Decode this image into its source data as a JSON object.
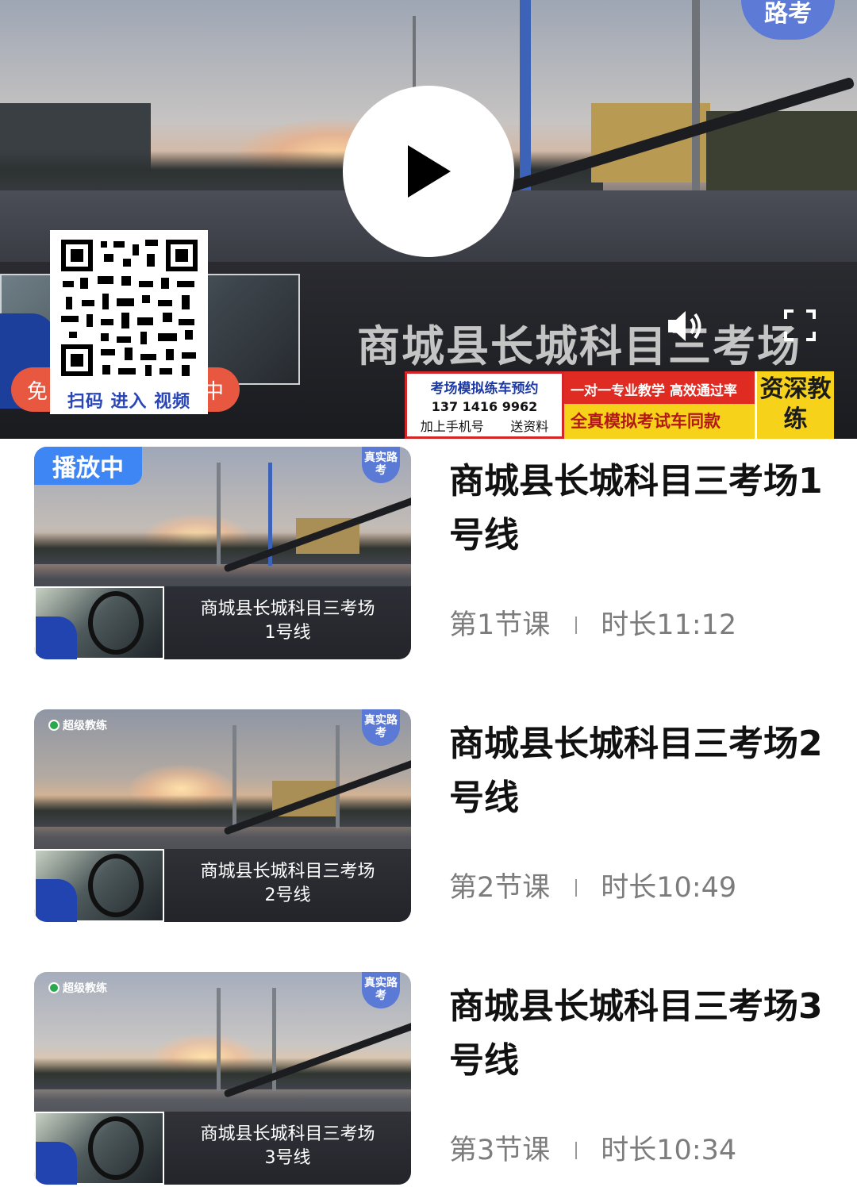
{
  "player": {
    "road_sign": "路考",
    "overlay_title": "商城县长城科目三考场",
    "qr_caption": "扫码 进入 视频",
    "promo_pill_left": "免",
    "promo_pill_right": "中",
    "ad_box": {
      "line1": "考场模拟练车预约",
      "phone": "137 1416 9962",
      "line3_left": "加上手机号",
      "line3_right": "送资料"
    },
    "ad_banner": {
      "line1": "一对一专业教学 高效通过率",
      "line2": "全真模拟考试车同款"
    },
    "ad_tag": "资深教练"
  },
  "lessons": [
    {
      "playing_label": "播放中",
      "title": "商城县长城科目三考场1号线",
      "section": "第1节课",
      "duration": "时长11:12",
      "thumb_caption_1": "商城县长城科目三考场",
      "thumb_caption_2": "1号线",
      "badge": "真实路考"
    },
    {
      "title": "商城县长城科目三考场2号线",
      "section": "第2节课",
      "duration": "时长10:49",
      "thumb_caption_1": "商城县长城科目三考场",
      "thumb_caption_2": "2号线",
      "badge": "真实路考",
      "brand": "超级教练"
    },
    {
      "title": "商城县长城科目三考场3号线",
      "section": "第3节课",
      "duration": "时长10:34",
      "thumb_caption_1": "商城县长城科目三考场",
      "thumb_caption_2": "3号线",
      "badge": "真实路考",
      "brand": "超级教练"
    }
  ]
}
